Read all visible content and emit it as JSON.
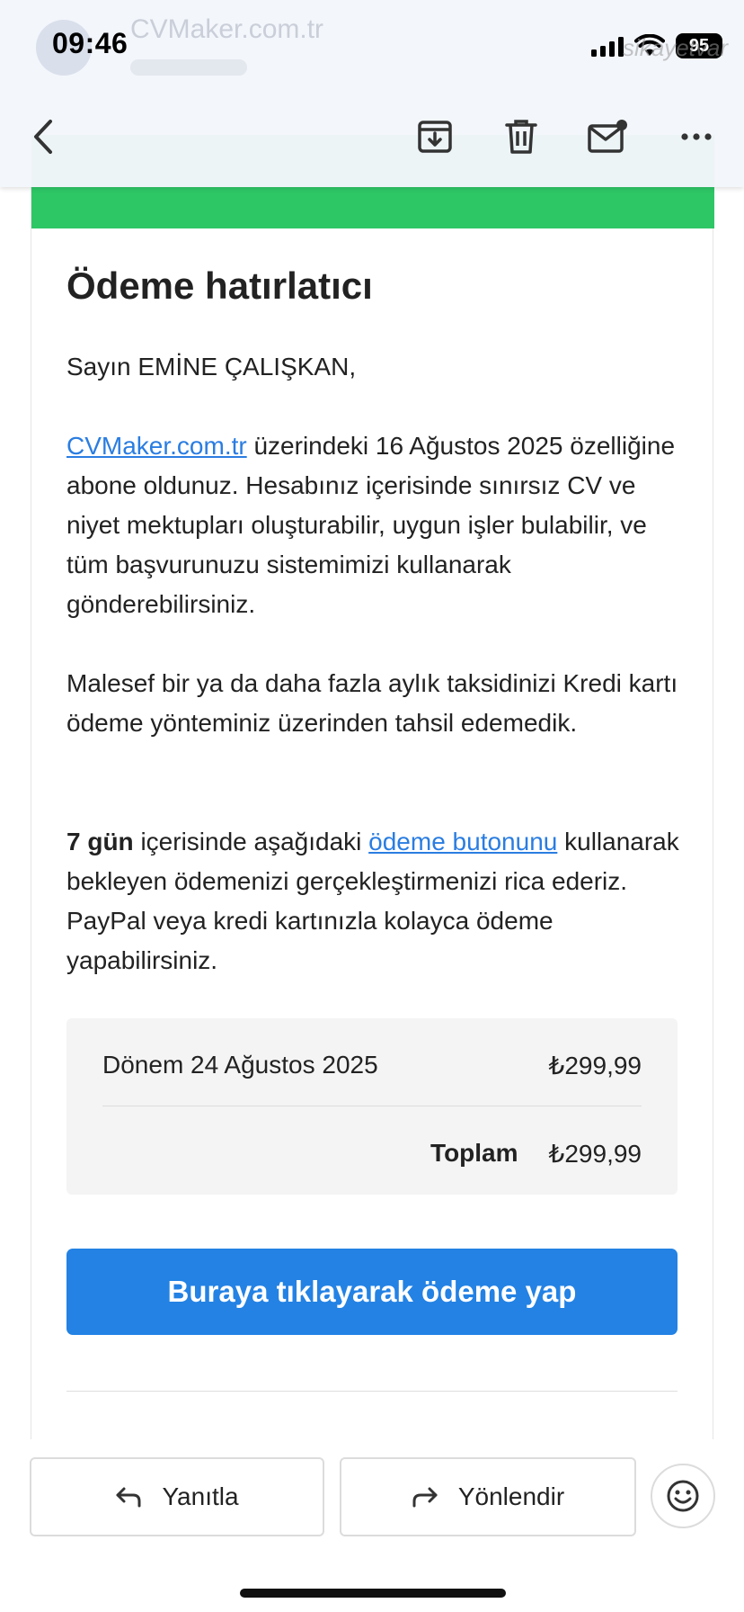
{
  "status_bar": {
    "time": "09:46",
    "battery": "95",
    "watermark": "sikayetvar"
  },
  "header": {
    "sender_ghost": "CVMaker.com.tr"
  },
  "toolbar": {
    "back_icon": "chevron-left-icon",
    "archive_icon": "archive-icon",
    "delete_icon": "trash-icon",
    "mark_unread_icon": "mail-unread-icon",
    "more_icon": "more-horizontal-icon"
  },
  "email": {
    "title": "Ödeme hatırlatıcı",
    "greeting": "Sayın EMİNE ÇALIŞKAN,",
    "p1_link": "CVMaker.com.tr",
    "p1_text": " üzerindeki 16 Ağustos 2025 özelliğine abone oldunuz. Hesabınız içerisinde sınırsız CV ve niyet mektupları oluşturabilir, uygun işler bulabilir, ve tüm başvurunuzu sistemimizi kullanarak gönderebilirsiniz.",
    "p2": "Malesef bir ya da daha fazla aylık taksidinizi Kredi kartı ödeme yönteminiz üzerinden tahsil edemedik.",
    "p3_bold": "7 gün",
    "p3_text1": " içerisinde aşağıdaki ",
    "p3_link": "ödeme butonunu",
    "p3_text2": " kullanarak bekleyen ödemenizi gerçekleştirmenizi rica ederiz. PayPal veya kredi kartınızla kolayca ödeme yapabilirsiniz.",
    "summary": {
      "period_label": "Dönem 24 Ağustos 2025",
      "period_amount": "₺299,99",
      "total_label": "Toplam",
      "total_amount": "₺299,99"
    },
    "pay_button": "Buraya tıklayarak ödeme yap"
  },
  "actions": {
    "reply_label": "Yanıtla",
    "forward_label": "Yönlendir",
    "reply_icon": "reply-icon",
    "forward_icon": "forward-icon",
    "emoji_icon": "emoji-smile-icon"
  },
  "colors": {
    "accent_green": "#2ec766",
    "link_blue": "#2a7de1",
    "button_blue": "#2382e4"
  }
}
